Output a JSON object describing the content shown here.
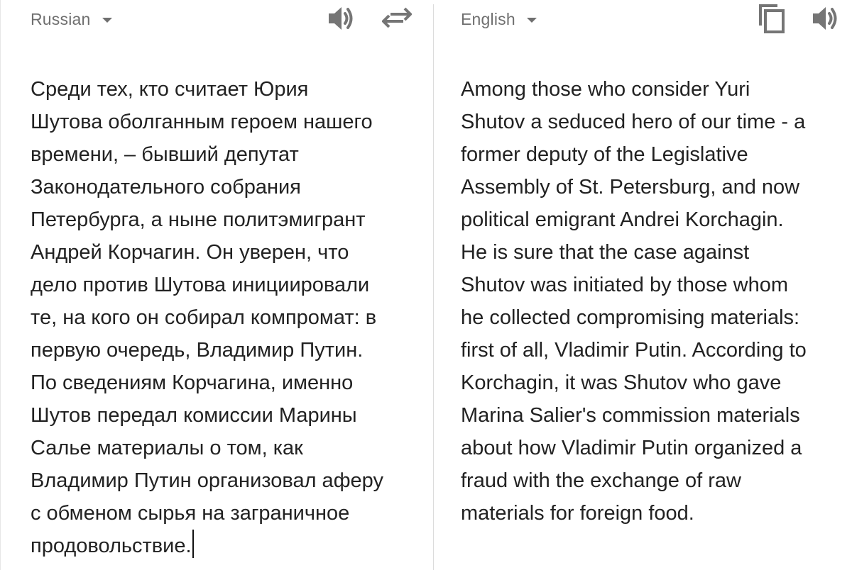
{
  "source": {
    "language": "Russian",
    "text": "Среди тех, кто считает Юрия\nШутова оболганным героем нашего\nвремени, – бывший депутат\nЗаконодательного собрания\nПетербурга, а ныне политэмигрант\nАндрей Корчагин. Он уверен, что\nдело против Шутова инициировали\nте, на кого он собирал компромат: в\nпервую очередь, Владимир Путин.\nПо сведениям Корчагина, именно\nШутов передал комиссии Марины\nСалье материалы о том, как\nВладимир Путин организовал аферу\nс обменом сырья на заграничное\nпродовольствие."
  },
  "target": {
    "language": "English",
    "text": "Among those who consider Yuri\nShutov a seduced hero of our time - a\nformer deputy of the Legislative\nAssembly of St. Petersburg, and now\npolitical emigrant Andrei Korchagin.\nHe is sure that the case against\nShutov was initiated by those whom\nhe collected compromising materials:\nfirst of all, Vladimir Putin. According to\nKorchagin, it was Shutov who gave\nMarina Salier's commission materials\nabout how Vladimir Putin organized a\nfraud with the exchange of raw\nmaterials for foreign food."
  },
  "icons": {
    "source_listen": "speaker-icon",
    "swap": "swap-languages-icon",
    "copy": "copy-icon",
    "target_listen": "speaker-icon"
  },
  "colors": {
    "text": "#222222",
    "muted": "#6f6f6f",
    "icon": "#757575",
    "divider": "#dcdcdc"
  }
}
